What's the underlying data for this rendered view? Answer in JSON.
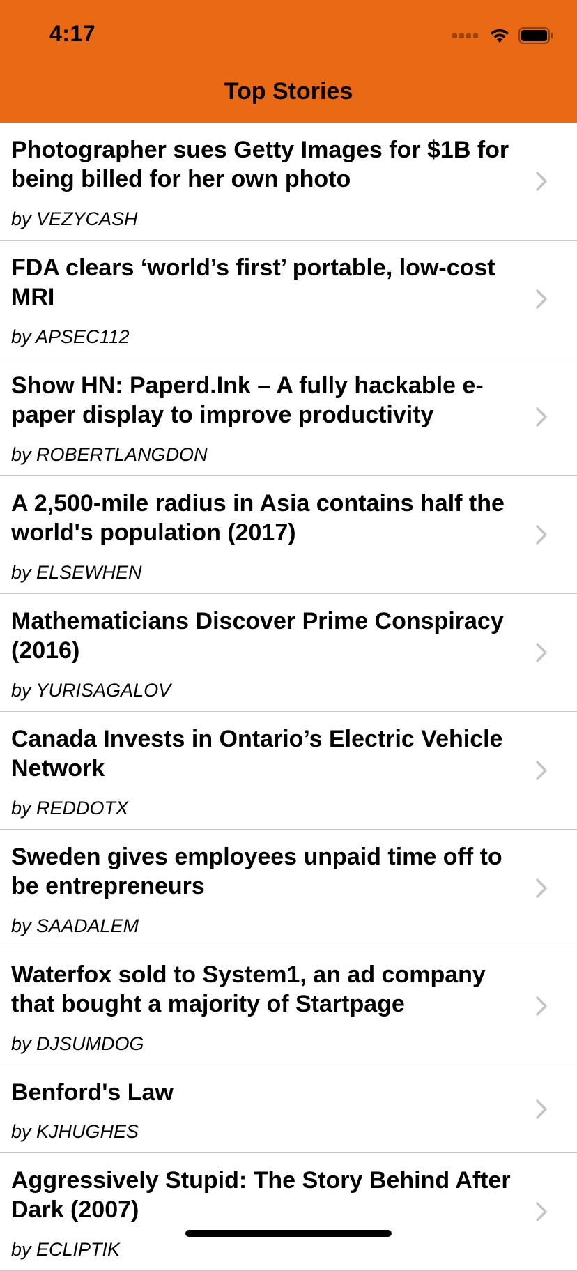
{
  "status_bar": {
    "time": "4:17",
    "icons": [
      "signal-icon",
      "wifi-icon",
      "battery-icon"
    ]
  },
  "nav": {
    "title": "Top Stories"
  },
  "colors": {
    "header": "#EA6915",
    "separator": "#c8c7cc",
    "chevron": "#c4c4c7"
  },
  "stories": [
    {
      "title": "Photographer sues Getty Images for $1B for being billed for her own photo",
      "author": "by VEZYCASH"
    },
    {
      "title": "FDA clears ‘world’s first’ portable, low-cost MRI",
      "author": "by APSEC112"
    },
    {
      "title": "Show HN: Paperd.Ink – A fully hackable e-paper display to improve productivity",
      "author": "by ROBERTLANGDON"
    },
    {
      "title": "A 2,500-mile radius in Asia contains half the world's population (2017)",
      "author": "by ELSEWHEN"
    },
    {
      "title": "Mathematicians Discover Prime Conspiracy (2016)",
      "author": "by YURISAGALOV"
    },
    {
      "title": "Canada Invests in Ontario’s Electric Vehicle Network",
      "author": "by REDDOTX"
    },
    {
      "title": "Sweden gives employees unpaid time off to be entrepreneurs",
      "author": "by SAADALEM"
    },
    {
      "title": "Waterfox sold to System1, an ad company that bought a majority of Startpage",
      "author": "by DJSUMDOG"
    },
    {
      "title": "Benford's Law",
      "author": "by KJHUGHES"
    },
    {
      "title": "Aggressively Stupid: The Story Behind After Dark (2007)",
      "author": "by ECLIPTIK"
    }
  ]
}
